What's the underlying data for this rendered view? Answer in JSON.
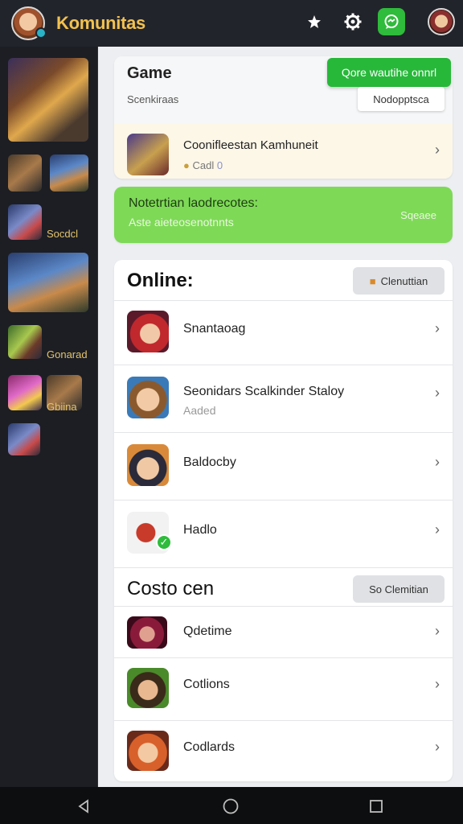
{
  "app": {
    "title": "Komunitas"
  },
  "topbar": {
    "star_icon": "star-icon",
    "settings_icon": "gear-icon",
    "message_icon": "chat-icon"
  },
  "sidebar": {
    "labels": [
      "Socdcl",
      "Gonarad",
      "Gbiina"
    ]
  },
  "game_card": {
    "title": "Game",
    "subtitle": "Scenkiraas",
    "primary_button": "Qore wautihe onnrl",
    "secondary_button": "Nodopptsca",
    "featured": {
      "title": "Coonifleestan Kamhuneit",
      "meta_label": "Cadl",
      "meta_count": "0"
    }
  },
  "notification_card": {
    "title": "Notetrtian laodrecotes:",
    "subtitle": "Aste aieteosenotnnts",
    "action": "Sqeaee"
  },
  "online": {
    "title": "Online:",
    "button": "Clenuttian",
    "items": [
      {
        "name": "Snantaoag",
        "status": ""
      },
      {
        "name": "Seonidars Scalkinder Staloy",
        "status": "Aaded"
      },
      {
        "name": "Baldocby",
        "status": ""
      },
      {
        "name": "Hadlo",
        "status": ""
      }
    ]
  },
  "section2": {
    "title": "Costo cen",
    "button": "So Clemitian",
    "items": [
      {
        "name": "Qdetime"
      },
      {
        "name": "Cotlions"
      },
      {
        "name": "Codlards"
      }
    ]
  },
  "navbar": {
    "back": "◁",
    "home": "○",
    "recents": "□"
  },
  "colors": {
    "accent_green": "#2fbb3b",
    "title_gold": "#f2c14e",
    "notification_green": "#7ed957"
  }
}
